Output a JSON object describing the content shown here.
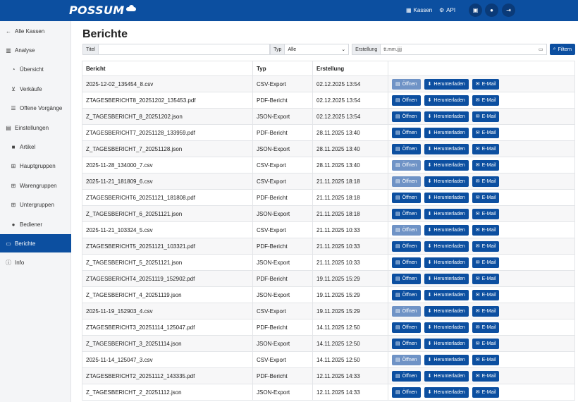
{
  "header": {
    "logo": "POSSUM",
    "links": [
      {
        "icon": "cash-register-icon",
        "glyph": "▦",
        "label": "Kassen"
      },
      {
        "icon": "sitemap-icon",
        "glyph": "⚙",
        "label": "API"
      }
    ],
    "circle_buttons": [
      {
        "icon": "toolbox-icon",
        "glyph": "▣"
      },
      {
        "icon": "user-gear-icon",
        "glyph": "●"
      },
      {
        "icon": "logout-icon",
        "glyph": "⇥"
      }
    ]
  },
  "sidebar": {
    "items": [
      {
        "label": "Alle Kassen",
        "icon": "arrow-left-icon",
        "glyph": "←",
        "level": 0,
        "active": false
      },
      {
        "label": "Analyse",
        "icon": "chart-icon",
        "glyph": "▥",
        "level": 0,
        "active": false
      },
      {
        "label": "Übersicht",
        "icon": "gauge-icon",
        "glyph": "◔",
        "level": 1,
        "active": false
      },
      {
        "label": "Verkäufe",
        "icon": "cart-icon",
        "glyph": "⊻",
        "level": 1,
        "active": false
      },
      {
        "label": "Offene Vorgänge",
        "icon": "list-icon",
        "glyph": "☰",
        "level": 1,
        "active": false
      },
      {
        "label": "Einstellungen",
        "icon": "sliders-icon",
        "glyph": "▤",
        "level": 0,
        "active": false
      },
      {
        "label": "Artikel",
        "icon": "box-icon",
        "glyph": "■",
        "level": 1,
        "active": false
      },
      {
        "label": "Hauptgruppen",
        "icon": "hierarchy-icon",
        "glyph": "⊞",
        "level": 1,
        "active": false
      },
      {
        "label": "Warengruppen",
        "icon": "hierarchy-icon",
        "glyph": "⊞",
        "level": 1,
        "active": false
      },
      {
        "label": "Untergruppen",
        "icon": "hierarchy-icon",
        "glyph": "⊞",
        "level": 1,
        "active": false
      },
      {
        "label": "Bediener",
        "icon": "users-icon",
        "glyph": "●",
        "level": 1,
        "active": false
      },
      {
        "label": "Berichte",
        "icon": "folder-open-icon",
        "glyph": "▭",
        "level": 0,
        "active": true
      },
      {
        "label": "Info",
        "icon": "info-icon",
        "glyph": "ⓘ",
        "level": 0,
        "active": false
      }
    ]
  },
  "page": {
    "title": "Berichte"
  },
  "filters": {
    "title_label": "Titel",
    "title_value": "",
    "type_label": "Typ",
    "type_value": "Alle",
    "date_label": "Erstellung",
    "date_placeholder": "tt.mm.jjjj",
    "filter_button": "Filtern"
  },
  "table": {
    "headers": {
      "name": "Bericht",
      "type": "Typ",
      "date": "Erstellung"
    },
    "actions": {
      "open": "Öffnen",
      "download": "Herunterladen",
      "email": "E-Mail"
    },
    "rows": [
      {
        "name": "2025-12-02_135454_8.csv",
        "type": "CSV-Export",
        "date": "02.12.2025 13:54",
        "open_disabled": true
      },
      {
        "name": "ZTAGESBERICHT8_20251202_135453.pdf",
        "type": "PDF-Bericht",
        "date": "02.12.2025 13:54",
        "open_disabled": false
      },
      {
        "name": "Z_TAGESBERICHT_8_20251202.json",
        "type": "JSON-Export",
        "date": "02.12.2025 13:54",
        "open_disabled": false
      },
      {
        "name": "ZTAGESBERICHT7_20251128_133959.pdf",
        "type": "PDF-Bericht",
        "date": "28.11.2025 13:40",
        "open_disabled": false
      },
      {
        "name": "Z_TAGESBERICHT_7_20251128.json",
        "type": "JSON-Export",
        "date": "28.11.2025 13:40",
        "open_disabled": false
      },
      {
        "name": "2025-11-28_134000_7.csv",
        "type": "CSV-Export",
        "date": "28.11.2025 13:40",
        "open_disabled": true
      },
      {
        "name": "2025-11-21_181809_6.csv",
        "type": "CSV-Export",
        "date": "21.11.2025 18:18",
        "open_disabled": true
      },
      {
        "name": "ZTAGESBERICHT6_20251121_181808.pdf",
        "type": "PDF-Bericht",
        "date": "21.11.2025 18:18",
        "open_disabled": false
      },
      {
        "name": "Z_TAGESBERICHT_6_20251121.json",
        "type": "JSON-Export",
        "date": "21.11.2025 18:18",
        "open_disabled": false
      },
      {
        "name": "2025-11-21_103324_5.csv",
        "type": "CSV-Export",
        "date": "21.11.2025 10:33",
        "open_disabled": true
      },
      {
        "name": "ZTAGESBERICHT5_20251121_103321.pdf",
        "type": "PDF-Bericht",
        "date": "21.11.2025 10:33",
        "open_disabled": false
      },
      {
        "name": "Z_TAGESBERICHT_5_20251121.json",
        "type": "JSON-Export",
        "date": "21.11.2025 10:33",
        "open_disabled": false
      },
      {
        "name": "ZTAGESBERICHT4_20251119_152902.pdf",
        "type": "PDF-Bericht",
        "date": "19.11.2025 15:29",
        "open_disabled": false
      },
      {
        "name": "Z_TAGESBERICHT_4_20251119.json",
        "type": "JSON-Export",
        "date": "19.11.2025 15:29",
        "open_disabled": false
      },
      {
        "name": "2025-11-19_152903_4.csv",
        "type": "CSV-Export",
        "date": "19.11.2025 15:29",
        "open_disabled": true
      },
      {
        "name": "ZTAGESBERICHT3_20251114_125047.pdf",
        "type": "PDF-Bericht",
        "date": "14.11.2025 12:50",
        "open_disabled": false
      },
      {
        "name": "Z_TAGESBERICHT_3_20251114.json",
        "type": "JSON-Export",
        "date": "14.11.2025 12:50",
        "open_disabled": false
      },
      {
        "name": "2025-11-14_125047_3.csv",
        "type": "CSV-Export",
        "date": "14.11.2025 12:50",
        "open_disabled": true
      },
      {
        "name": "ZTAGESBERICHT2_20251112_143335.pdf",
        "type": "PDF-Bericht",
        "date": "12.11.2025 14:33",
        "open_disabled": false
      },
      {
        "name": "Z_TAGESBERICHT_2_20251112.json",
        "type": "JSON-Export",
        "date": "12.11.2025 14:33",
        "open_disabled": false
      }
    ]
  },
  "colors": {
    "primary": "#0c4fa0",
    "disabled_button": "#6f93c6",
    "sidebar_bg": "#f4f5f7"
  }
}
